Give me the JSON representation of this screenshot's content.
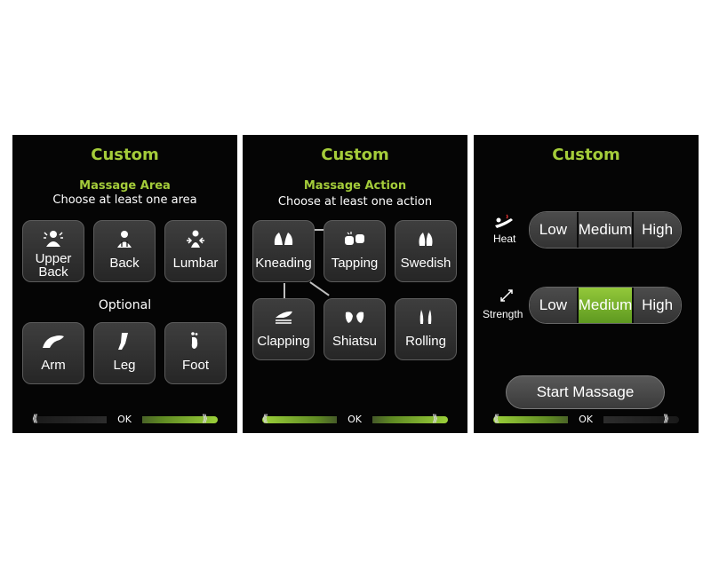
{
  "panels": [
    {
      "title": "Custom",
      "subtitle": "Massage  Area",
      "instruction": "Choose at least one area",
      "tiles": [
        {
          "label": "Upper\nBack",
          "icon": "upper-back-icon"
        },
        {
          "label": "Back",
          "icon": "back-icon"
        },
        {
          "label": "Lumbar",
          "icon": "lumbar-icon"
        }
      ],
      "optional_label": "Optional",
      "optional_tiles": [
        {
          "label": "Arm",
          "icon": "arm-icon"
        },
        {
          "label": "Leg",
          "icon": "leg-icon"
        },
        {
          "label": "Foot",
          "icon": "foot-icon"
        }
      ],
      "ok_label": "OK"
    },
    {
      "title": "Custom",
      "subtitle": "Massage Action",
      "instruction": "Choose at least one action",
      "tiles": [
        {
          "label": "Kneading",
          "icon": "kneading-icon"
        },
        {
          "label": "Tapping",
          "icon": "tapping-icon"
        },
        {
          "label": "Swedish",
          "icon": "swedish-icon"
        },
        {
          "label": "Clapping",
          "icon": "clapping-icon"
        },
        {
          "label": "Shiatsu",
          "icon": "shiatsu-icon"
        },
        {
          "label": "Rolling",
          "icon": "rolling-icon"
        }
      ],
      "ok_label": "OK"
    },
    {
      "title": "Custom",
      "rows": [
        {
          "label": "Heat",
          "icon": "heat-icon",
          "options": [
            "Low",
            "Medium",
            "High"
          ],
          "selected": null
        },
        {
          "label": "Strength",
          "icon": "strength-icon",
          "options": [
            "Low",
            "Medium",
            "High"
          ],
          "selected": "Medium"
        }
      ],
      "start_label": "Start Massage",
      "ok_label": "OK"
    }
  ],
  "colors": {
    "accent_green": "#a4cc3a",
    "selected_green": "#7ab52e",
    "panel_bg": "#050505",
    "tile_bg": "#2f2f2f"
  }
}
